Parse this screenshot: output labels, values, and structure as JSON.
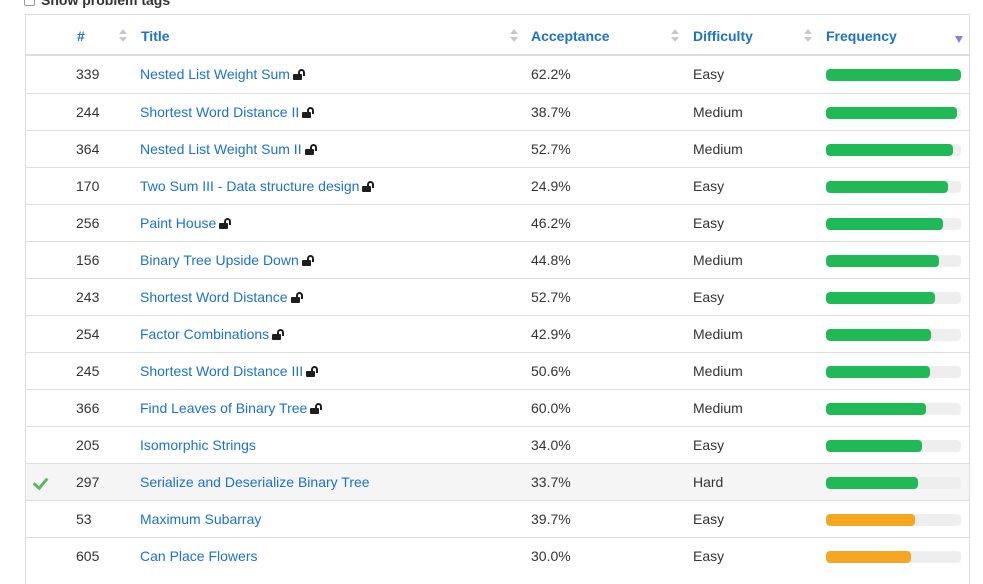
{
  "colors": {
    "link": "#1a73c8",
    "bar_green": "#1fba56",
    "bar_orange": "#f5a623",
    "bar_track": "#eeeeee",
    "check_green": "#5cb85c",
    "sort_active": "#8a7fd8"
  },
  "filter": {
    "show_tags_label": "Show problem tags",
    "checked": false
  },
  "table": {
    "headers": {
      "num": "#",
      "title": "Title",
      "acceptance": "Acceptance",
      "difficulty": "Difficulty",
      "frequency": "Frequency"
    },
    "sorted_by": "frequency",
    "sort_direction": "descending",
    "rows": [
      {
        "num": "339",
        "title": "Nested List Weight Sum",
        "locked": true,
        "solved": false,
        "acceptance": "62.2%",
        "difficulty": "Easy",
        "frequency": 1.0,
        "bar_color": "green"
      },
      {
        "num": "244",
        "title": "Shortest Word Distance II",
        "locked": true,
        "solved": false,
        "acceptance": "38.7%",
        "difficulty": "Medium",
        "frequency": 0.97,
        "bar_color": "green"
      },
      {
        "num": "364",
        "title": "Nested List Weight Sum II",
        "locked": true,
        "solved": false,
        "acceptance": "52.7%",
        "difficulty": "Medium",
        "frequency": 0.94,
        "bar_color": "green"
      },
      {
        "num": "170",
        "title": "Two Sum III - Data structure design",
        "locked": true,
        "solved": false,
        "acceptance": "24.9%",
        "difficulty": "Easy",
        "frequency": 0.9,
        "bar_color": "green"
      },
      {
        "num": "256",
        "title": "Paint House",
        "locked": true,
        "solved": false,
        "acceptance": "46.2%",
        "difficulty": "Easy",
        "frequency": 0.87,
        "bar_color": "green"
      },
      {
        "num": "156",
        "title": "Binary Tree Upside Down",
        "locked": true,
        "solved": false,
        "acceptance": "44.8%",
        "difficulty": "Medium",
        "frequency": 0.84,
        "bar_color": "green"
      },
      {
        "num": "243",
        "title": "Shortest Word Distance",
        "locked": true,
        "solved": false,
        "acceptance": "52.7%",
        "difficulty": "Easy",
        "frequency": 0.81,
        "bar_color": "green"
      },
      {
        "num": "254",
        "title": "Factor Combinations",
        "locked": true,
        "solved": false,
        "acceptance": "42.9%",
        "difficulty": "Medium",
        "frequency": 0.78,
        "bar_color": "green"
      },
      {
        "num": "245",
        "title": "Shortest Word Distance III",
        "locked": true,
        "solved": false,
        "acceptance": "50.6%",
        "difficulty": "Medium",
        "frequency": 0.77,
        "bar_color": "green"
      },
      {
        "num": "366",
        "title": "Find Leaves of Binary Tree",
        "locked": true,
        "solved": false,
        "acceptance": "60.0%",
        "difficulty": "Medium",
        "frequency": 0.74,
        "bar_color": "green"
      },
      {
        "num": "205",
        "title": "Isomorphic Strings",
        "locked": false,
        "solved": false,
        "acceptance": "34.0%",
        "difficulty": "Easy",
        "frequency": 0.71,
        "bar_color": "green"
      },
      {
        "num": "297",
        "title": "Serialize and Deserialize Binary Tree",
        "locked": false,
        "solved": true,
        "acceptance": "33.7%",
        "difficulty": "Hard",
        "frequency": 0.68,
        "bar_color": "green"
      },
      {
        "num": "53",
        "title": "Maximum Subarray",
        "locked": false,
        "solved": false,
        "acceptance": "39.7%",
        "difficulty": "Easy",
        "frequency": 0.66,
        "bar_color": "orange"
      },
      {
        "num": "605",
        "title": "Can Place Flowers",
        "locked": false,
        "solved": false,
        "acceptance": "30.0%",
        "difficulty": "Easy",
        "frequency": 0.63,
        "bar_color": "orange"
      }
    ]
  }
}
